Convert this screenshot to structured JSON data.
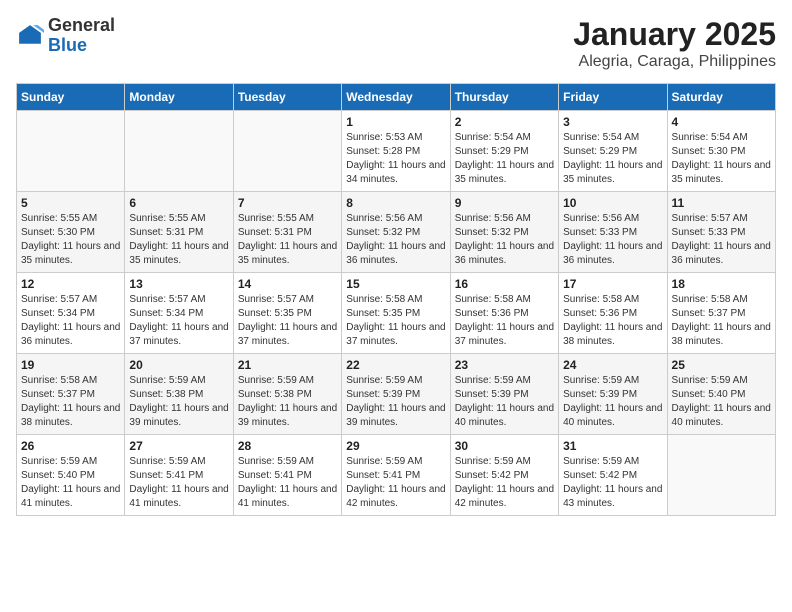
{
  "logo": {
    "general": "General",
    "blue": "Blue"
  },
  "header": {
    "title": "January 2025",
    "subtitle": "Alegria, Caraga, Philippines"
  },
  "weekdays": [
    "Sunday",
    "Monday",
    "Tuesday",
    "Wednesday",
    "Thursday",
    "Friday",
    "Saturday"
  ],
  "weeks": [
    [
      {
        "day": "",
        "info": ""
      },
      {
        "day": "",
        "info": ""
      },
      {
        "day": "",
        "info": ""
      },
      {
        "day": "1",
        "info": "Sunrise: 5:53 AM\nSunset: 5:28 PM\nDaylight: 11 hours and 34 minutes."
      },
      {
        "day": "2",
        "info": "Sunrise: 5:54 AM\nSunset: 5:29 PM\nDaylight: 11 hours and 35 minutes."
      },
      {
        "day": "3",
        "info": "Sunrise: 5:54 AM\nSunset: 5:29 PM\nDaylight: 11 hours and 35 minutes."
      },
      {
        "day": "4",
        "info": "Sunrise: 5:54 AM\nSunset: 5:30 PM\nDaylight: 11 hours and 35 minutes."
      }
    ],
    [
      {
        "day": "5",
        "info": "Sunrise: 5:55 AM\nSunset: 5:30 PM\nDaylight: 11 hours and 35 minutes."
      },
      {
        "day": "6",
        "info": "Sunrise: 5:55 AM\nSunset: 5:31 PM\nDaylight: 11 hours and 35 minutes."
      },
      {
        "day": "7",
        "info": "Sunrise: 5:55 AM\nSunset: 5:31 PM\nDaylight: 11 hours and 35 minutes."
      },
      {
        "day": "8",
        "info": "Sunrise: 5:56 AM\nSunset: 5:32 PM\nDaylight: 11 hours and 36 minutes."
      },
      {
        "day": "9",
        "info": "Sunrise: 5:56 AM\nSunset: 5:32 PM\nDaylight: 11 hours and 36 minutes."
      },
      {
        "day": "10",
        "info": "Sunrise: 5:56 AM\nSunset: 5:33 PM\nDaylight: 11 hours and 36 minutes."
      },
      {
        "day": "11",
        "info": "Sunrise: 5:57 AM\nSunset: 5:33 PM\nDaylight: 11 hours and 36 minutes."
      }
    ],
    [
      {
        "day": "12",
        "info": "Sunrise: 5:57 AM\nSunset: 5:34 PM\nDaylight: 11 hours and 36 minutes."
      },
      {
        "day": "13",
        "info": "Sunrise: 5:57 AM\nSunset: 5:34 PM\nDaylight: 11 hours and 37 minutes."
      },
      {
        "day": "14",
        "info": "Sunrise: 5:57 AM\nSunset: 5:35 PM\nDaylight: 11 hours and 37 minutes."
      },
      {
        "day": "15",
        "info": "Sunrise: 5:58 AM\nSunset: 5:35 PM\nDaylight: 11 hours and 37 minutes."
      },
      {
        "day": "16",
        "info": "Sunrise: 5:58 AM\nSunset: 5:36 PM\nDaylight: 11 hours and 37 minutes."
      },
      {
        "day": "17",
        "info": "Sunrise: 5:58 AM\nSunset: 5:36 PM\nDaylight: 11 hours and 38 minutes."
      },
      {
        "day": "18",
        "info": "Sunrise: 5:58 AM\nSunset: 5:37 PM\nDaylight: 11 hours and 38 minutes."
      }
    ],
    [
      {
        "day": "19",
        "info": "Sunrise: 5:58 AM\nSunset: 5:37 PM\nDaylight: 11 hours and 38 minutes."
      },
      {
        "day": "20",
        "info": "Sunrise: 5:59 AM\nSunset: 5:38 PM\nDaylight: 11 hours and 39 minutes."
      },
      {
        "day": "21",
        "info": "Sunrise: 5:59 AM\nSunset: 5:38 PM\nDaylight: 11 hours and 39 minutes."
      },
      {
        "day": "22",
        "info": "Sunrise: 5:59 AM\nSunset: 5:39 PM\nDaylight: 11 hours and 39 minutes."
      },
      {
        "day": "23",
        "info": "Sunrise: 5:59 AM\nSunset: 5:39 PM\nDaylight: 11 hours and 40 minutes."
      },
      {
        "day": "24",
        "info": "Sunrise: 5:59 AM\nSunset: 5:39 PM\nDaylight: 11 hours and 40 minutes."
      },
      {
        "day": "25",
        "info": "Sunrise: 5:59 AM\nSunset: 5:40 PM\nDaylight: 11 hours and 40 minutes."
      }
    ],
    [
      {
        "day": "26",
        "info": "Sunrise: 5:59 AM\nSunset: 5:40 PM\nDaylight: 11 hours and 41 minutes."
      },
      {
        "day": "27",
        "info": "Sunrise: 5:59 AM\nSunset: 5:41 PM\nDaylight: 11 hours and 41 minutes."
      },
      {
        "day": "28",
        "info": "Sunrise: 5:59 AM\nSunset: 5:41 PM\nDaylight: 11 hours and 41 minutes."
      },
      {
        "day": "29",
        "info": "Sunrise: 5:59 AM\nSunset: 5:41 PM\nDaylight: 11 hours and 42 minutes."
      },
      {
        "day": "30",
        "info": "Sunrise: 5:59 AM\nSunset: 5:42 PM\nDaylight: 11 hours and 42 minutes."
      },
      {
        "day": "31",
        "info": "Sunrise: 5:59 AM\nSunset: 5:42 PM\nDaylight: 11 hours and 43 minutes."
      },
      {
        "day": "",
        "info": ""
      }
    ]
  ]
}
